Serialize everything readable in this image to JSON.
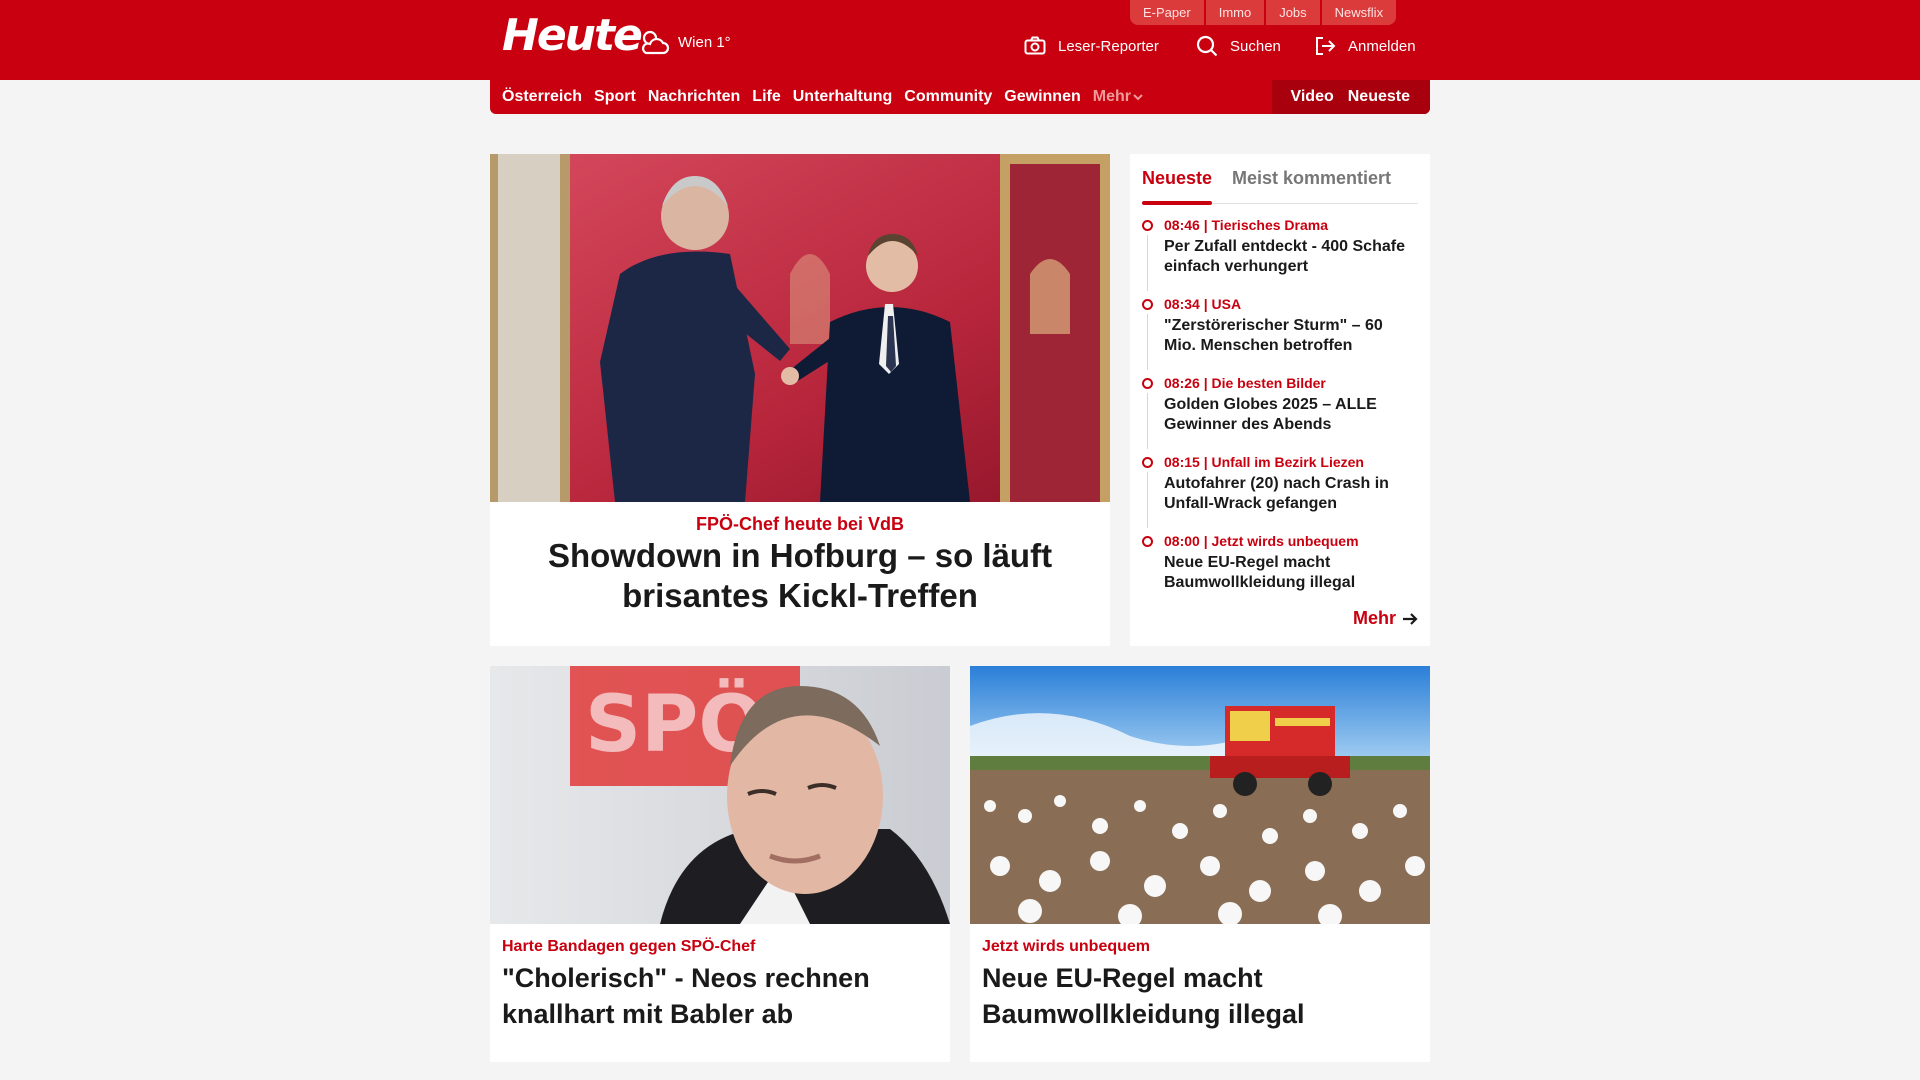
{
  "header": {
    "logo": "Heute",
    "weather": "Wien 1°",
    "quicklinks": [
      "E-Paper",
      "Immo",
      "Jobs",
      "Newsflix"
    ],
    "actions": {
      "reporter": "Leser-Reporter",
      "search": "Suchen",
      "login": "Anmelden"
    }
  },
  "nav": {
    "items": [
      "Österreich",
      "Sport",
      "Nachrichten",
      "Life",
      "Unterhaltung",
      "Community",
      "Gewinnen"
    ],
    "more": "Mehr",
    "right": [
      "Video",
      "Neueste"
    ]
  },
  "hero": {
    "kicker": "FPÖ-Chef heute bei VdB",
    "title": "Showdown in Hofburg – so läuft brisantes Kickl-Treffen"
  },
  "sidebar": {
    "tabs": [
      "Neueste",
      "Meist kommentiert"
    ],
    "items": [
      {
        "meta": "08:46 | Tierisches Drama",
        "title": "Per Zufall entdeckt - 400 Schafe einfach verhungert"
      },
      {
        "meta": "08:34 | USA",
        "title": "\"Zerstörerischer Sturm\" – 60 Mio. Menschen betroffen"
      },
      {
        "meta": "08:26 | Die besten Bilder",
        "title": "Golden Globes 2025 – ALLE Gewinner des Abends"
      },
      {
        "meta": "08:15 | Unfall im Bezirk Liezen",
        "title": "Autofahrer (20) nach Crash in Unfall-Wrack gefangen"
      },
      {
        "meta": "08:00 | Jetzt wirds unbequem",
        "title": "Neue EU-Regel macht Baumwollkleidung illegal"
      }
    ],
    "more": "Mehr"
  },
  "cards": [
    {
      "kicker": "Harte Bandagen gegen SPÖ-Chef",
      "title": "\"Cholerisch\" - Neos rechnen knallhart mit Babler ab",
      "image_text": "SPÖ"
    },
    {
      "kicker": "Jetzt wirds unbequem",
      "title": "Neue EU-Regel macht Baumwollkleidung illegal"
    }
  ],
  "colors": {
    "brand": "#c8000f",
    "brand_dark": "#a8000c",
    "background": "#f4f4f4"
  }
}
